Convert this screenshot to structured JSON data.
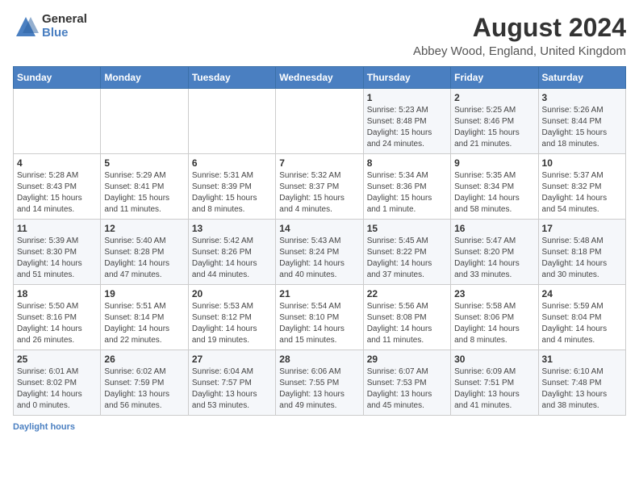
{
  "logo": {
    "general": "General",
    "blue": "Blue"
  },
  "title": "August 2024",
  "subtitle": "Abbey Wood, England, United Kingdom",
  "columns": [
    "Sunday",
    "Monday",
    "Tuesday",
    "Wednesday",
    "Thursday",
    "Friday",
    "Saturday"
  ],
  "footer": {
    "daylight_label": "Daylight hours"
  },
  "weeks": [
    [
      {
        "day": "",
        "info": ""
      },
      {
        "day": "",
        "info": ""
      },
      {
        "day": "",
        "info": ""
      },
      {
        "day": "",
        "info": ""
      },
      {
        "day": "1",
        "info": "Sunrise: 5:23 AM\nSunset: 8:48 PM\nDaylight: 15 hours\nand 24 minutes."
      },
      {
        "day": "2",
        "info": "Sunrise: 5:25 AM\nSunset: 8:46 PM\nDaylight: 15 hours\nand 21 minutes."
      },
      {
        "day": "3",
        "info": "Sunrise: 5:26 AM\nSunset: 8:44 PM\nDaylight: 15 hours\nand 18 minutes."
      }
    ],
    [
      {
        "day": "4",
        "info": "Sunrise: 5:28 AM\nSunset: 8:43 PM\nDaylight: 15 hours\nand 14 minutes."
      },
      {
        "day": "5",
        "info": "Sunrise: 5:29 AM\nSunset: 8:41 PM\nDaylight: 15 hours\nand 11 minutes."
      },
      {
        "day": "6",
        "info": "Sunrise: 5:31 AM\nSunset: 8:39 PM\nDaylight: 15 hours\nand 8 minutes."
      },
      {
        "day": "7",
        "info": "Sunrise: 5:32 AM\nSunset: 8:37 PM\nDaylight: 15 hours\nand 4 minutes."
      },
      {
        "day": "8",
        "info": "Sunrise: 5:34 AM\nSunset: 8:36 PM\nDaylight: 15 hours\nand 1 minute."
      },
      {
        "day": "9",
        "info": "Sunrise: 5:35 AM\nSunset: 8:34 PM\nDaylight: 14 hours\nand 58 minutes."
      },
      {
        "day": "10",
        "info": "Sunrise: 5:37 AM\nSunset: 8:32 PM\nDaylight: 14 hours\nand 54 minutes."
      }
    ],
    [
      {
        "day": "11",
        "info": "Sunrise: 5:39 AM\nSunset: 8:30 PM\nDaylight: 14 hours\nand 51 minutes."
      },
      {
        "day": "12",
        "info": "Sunrise: 5:40 AM\nSunset: 8:28 PM\nDaylight: 14 hours\nand 47 minutes."
      },
      {
        "day": "13",
        "info": "Sunrise: 5:42 AM\nSunset: 8:26 PM\nDaylight: 14 hours\nand 44 minutes."
      },
      {
        "day": "14",
        "info": "Sunrise: 5:43 AM\nSunset: 8:24 PM\nDaylight: 14 hours\nand 40 minutes."
      },
      {
        "day": "15",
        "info": "Sunrise: 5:45 AM\nSunset: 8:22 PM\nDaylight: 14 hours\nand 37 minutes."
      },
      {
        "day": "16",
        "info": "Sunrise: 5:47 AM\nSunset: 8:20 PM\nDaylight: 14 hours\nand 33 minutes."
      },
      {
        "day": "17",
        "info": "Sunrise: 5:48 AM\nSunset: 8:18 PM\nDaylight: 14 hours\nand 30 minutes."
      }
    ],
    [
      {
        "day": "18",
        "info": "Sunrise: 5:50 AM\nSunset: 8:16 PM\nDaylight: 14 hours\nand 26 minutes."
      },
      {
        "day": "19",
        "info": "Sunrise: 5:51 AM\nSunset: 8:14 PM\nDaylight: 14 hours\nand 22 minutes."
      },
      {
        "day": "20",
        "info": "Sunrise: 5:53 AM\nSunset: 8:12 PM\nDaylight: 14 hours\nand 19 minutes."
      },
      {
        "day": "21",
        "info": "Sunrise: 5:54 AM\nSunset: 8:10 PM\nDaylight: 14 hours\nand 15 minutes."
      },
      {
        "day": "22",
        "info": "Sunrise: 5:56 AM\nSunset: 8:08 PM\nDaylight: 14 hours\nand 11 minutes."
      },
      {
        "day": "23",
        "info": "Sunrise: 5:58 AM\nSunset: 8:06 PM\nDaylight: 14 hours\nand 8 minutes."
      },
      {
        "day": "24",
        "info": "Sunrise: 5:59 AM\nSunset: 8:04 PM\nDaylight: 14 hours\nand 4 minutes."
      }
    ],
    [
      {
        "day": "25",
        "info": "Sunrise: 6:01 AM\nSunset: 8:02 PM\nDaylight: 14 hours\nand 0 minutes."
      },
      {
        "day": "26",
        "info": "Sunrise: 6:02 AM\nSunset: 7:59 PM\nDaylight: 13 hours\nand 56 minutes."
      },
      {
        "day": "27",
        "info": "Sunrise: 6:04 AM\nSunset: 7:57 PM\nDaylight: 13 hours\nand 53 minutes."
      },
      {
        "day": "28",
        "info": "Sunrise: 6:06 AM\nSunset: 7:55 PM\nDaylight: 13 hours\nand 49 minutes."
      },
      {
        "day": "29",
        "info": "Sunrise: 6:07 AM\nSunset: 7:53 PM\nDaylight: 13 hours\nand 45 minutes."
      },
      {
        "day": "30",
        "info": "Sunrise: 6:09 AM\nSunset: 7:51 PM\nDaylight: 13 hours\nand 41 minutes."
      },
      {
        "day": "31",
        "info": "Sunrise: 6:10 AM\nSunset: 7:48 PM\nDaylight: 13 hours\nand 38 minutes."
      }
    ]
  ]
}
